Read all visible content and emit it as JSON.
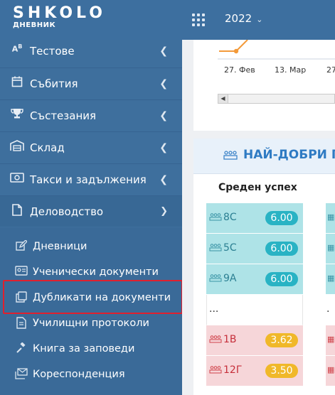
{
  "app": {
    "logo": "SHKOLO",
    "logo_subtitle": "ДНЕВНИК",
    "year": "2022"
  },
  "sidebar": {
    "items": [
      {
        "label": "Тестове",
        "icon": "ab-icon"
      },
      {
        "label": "Събития",
        "icon": "calendar-icon"
      },
      {
        "label": "Състезания",
        "icon": "trophy-icon"
      },
      {
        "label": "Склад",
        "icon": "warehouse-icon"
      },
      {
        "label": "Такси и задължения",
        "icon": "money-icon"
      },
      {
        "label": "Деловодство",
        "icon": "file-icon"
      }
    ],
    "subitems": [
      {
        "label": "Дневници",
        "icon": "edit-icon"
      },
      {
        "label": "Ученически документи",
        "icon": "id-card-icon"
      },
      {
        "label": "Дубликати на документи",
        "icon": "copy-icon"
      },
      {
        "label": "Училищни протоколи",
        "icon": "file-lines-icon"
      },
      {
        "label": "Книга за заповеди",
        "icon": "gavel-icon"
      },
      {
        "label": "Кореспонденция",
        "icon": "envelopes-icon"
      }
    ]
  },
  "chart_data": {
    "type": "line",
    "x_ticks": [
      "27. Фев",
      "13. Мар",
      "27"
    ],
    "series": [
      {
        "color": "#f39a3a",
        "x": [
          "27. Фев",
          "13. Мар"
        ],
        "values": [
          null,
          null
        ]
      }
    ]
  },
  "best": {
    "title": "НАЙ-ДОБРИ П",
    "column_title": "Среден успех",
    "rows": [
      {
        "class": "8С",
        "value": "6.00",
        "tone": "teal"
      },
      {
        "class": "5С",
        "value": "6.00",
        "tone": "teal"
      },
      {
        "class": "9А",
        "value": "6.00",
        "tone": "teal"
      },
      {
        "class": "...",
        "value": "",
        "tone": "white"
      },
      {
        "class": "1В",
        "value": "3.62",
        "tone": "pink"
      },
      {
        "class": "12Г",
        "value": "3.50",
        "tone": "pink"
      }
    ]
  },
  "colors": {
    "sidebar": "#3e6f9d",
    "topbar": "#3d6f9f",
    "highlight": "#e0202e",
    "teal_badge": "#29b3c4",
    "yellow_badge": "#f0b829"
  }
}
